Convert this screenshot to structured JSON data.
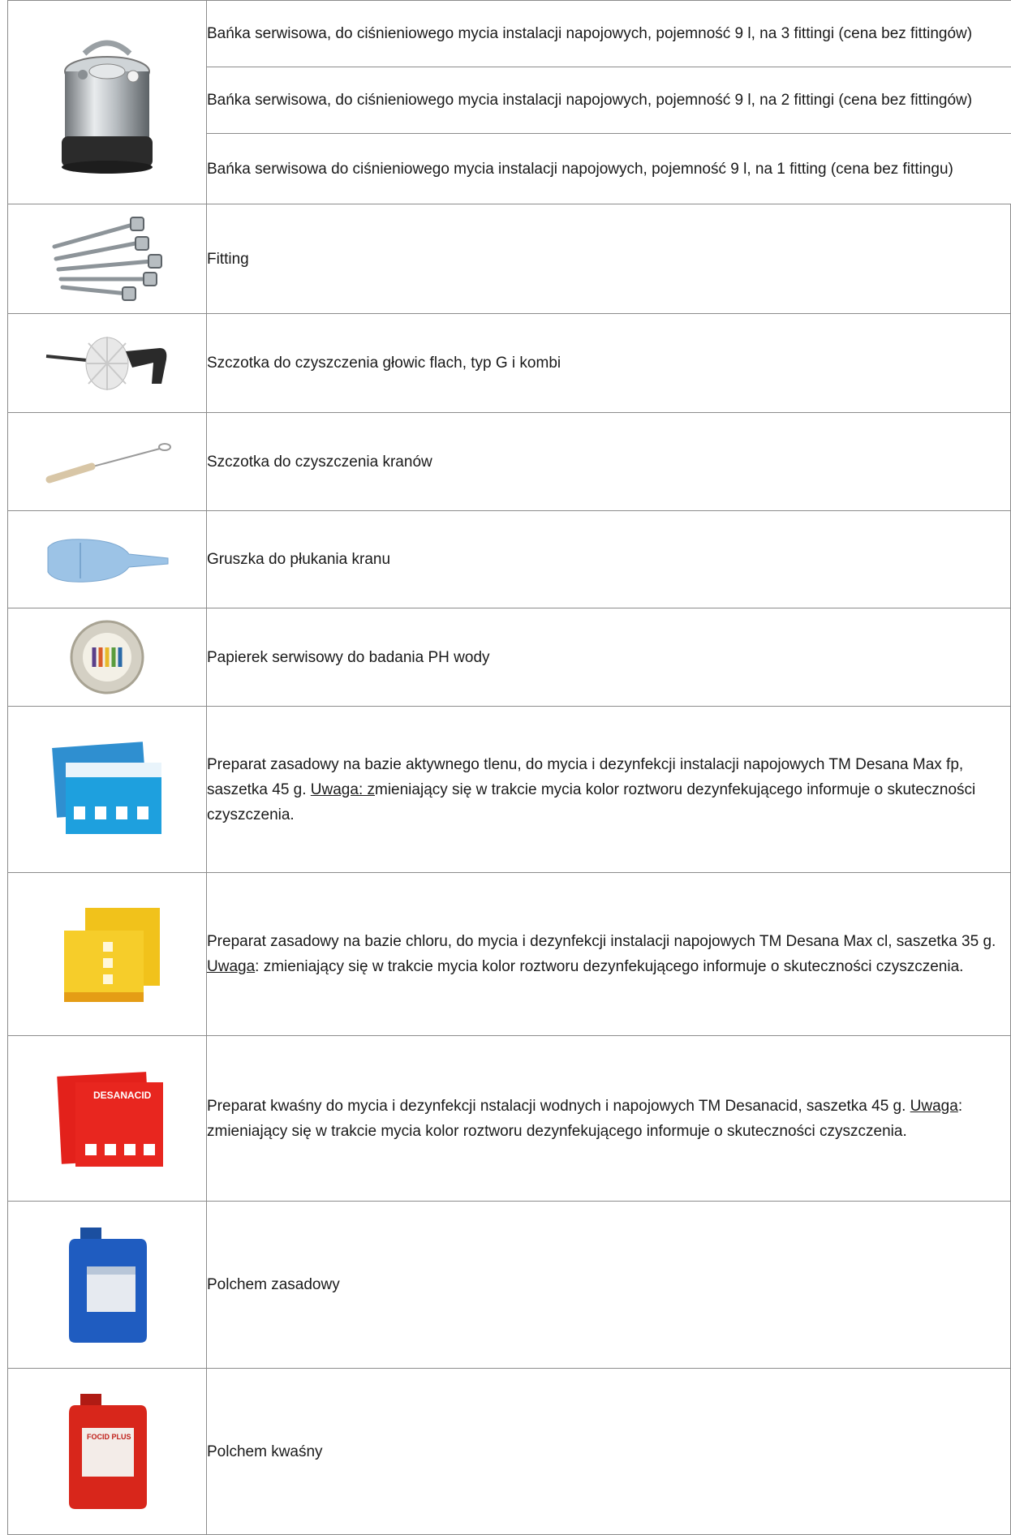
{
  "products": [
    {
      "image_icon": "service-keg-icon",
      "variants": [
        "Bańka serwisowa, do ciśnieniowego mycia instalacji napojowych, pojemność 9 l, na 3 fittingi (cena bez fittingów)",
        "Bańka serwisowa, do ciśnieniowego mycia instalacji napojowych, pojemność 9 l, na 2 fittingi (cena bez fittingów)",
        "Bańka serwisowa do ciśnieniowego mycia instalacji napojowych, pojemność 9 l, na 1 fitting (cena bez fittingu)"
      ]
    },
    {
      "image_icon": "fittings-icon",
      "text": "Fitting"
    },
    {
      "image_icon": "head-brush-icon",
      "text": "Szczotka do czyszczenia głowic flach, typ G i kombi"
    },
    {
      "image_icon": "tap-brush-icon",
      "text": "Szczotka do czyszczenia kranów"
    },
    {
      "image_icon": "rinse-bulb-icon",
      "text": "Gruszka do płukania kranu"
    },
    {
      "image_icon": "ph-paper-icon",
      "text": "Papierek serwisowy do badania PH wody"
    },
    {
      "image_icon": "desana-max-fp-sachet-icon",
      "text_before": "Preparat zasadowy na bazie aktywnego tlenu, do mycia i dezynfekcji instalacji napojowych TM Desana Max fp, saszetka 45 g. ",
      "note_label": "Uwaga: z",
      "text_after": "mieniający się w trakcie mycia kolor roztworu dezynfekującego informuje o skuteczności czyszczenia."
    },
    {
      "image_icon": "desana-max-cl-sachet-icon",
      "text_before": "Preparat zasadowy na bazie chloru, do mycia i dezynfekcji instalacji napojowych TM Desana Max cl, saszetka 35 g. ",
      "note_label": "Uwaga",
      "text_after": ": zmieniający się w trakcie mycia kolor roztworu dezynfekującego informuje o skuteczności czyszczenia."
    },
    {
      "image_icon": "desanacid-sachet-icon",
      "text_before": "Preparat kwaśny do mycia i dezynfekcji nstalacji wodnych i napojowych TM Desanacid, saszetka 45 g. ",
      "note_label": "Uwaga",
      "text_after": ": zmieniający się w trakcie mycia kolor roztworu dezynfekującego informuje o skuteczności czyszczenia."
    },
    {
      "image_icon": "blue-canister-icon",
      "text": "Polchem zasadowy"
    },
    {
      "image_icon": "red-canister-icon",
      "text": "Polchem kwaśny"
    }
  ],
  "sachet_labels": {
    "desanacid": "DESANACID",
    "canister_red": "FOCID PLUS"
  }
}
